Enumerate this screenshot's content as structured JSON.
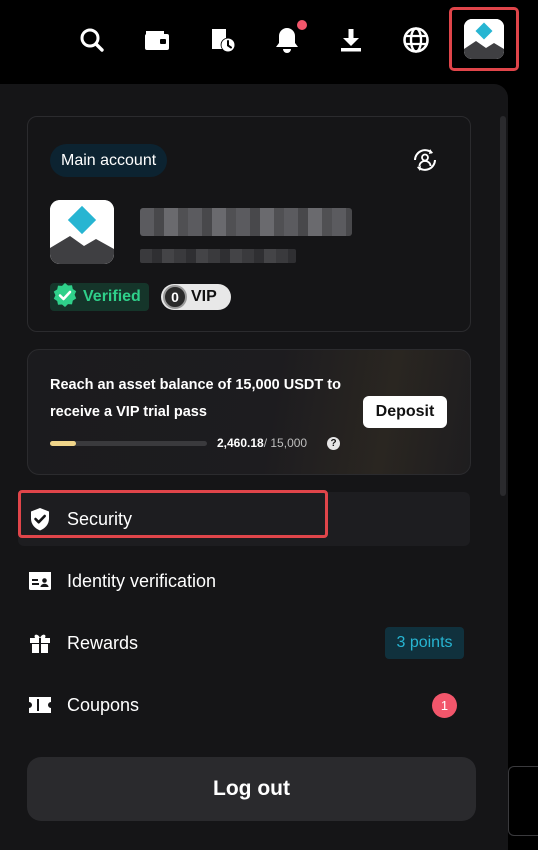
{
  "topbar": {
    "icons": [
      "search-icon",
      "wallet-icon",
      "order-history-icon",
      "bell-icon",
      "download-icon",
      "globe-icon"
    ],
    "notification_dot_color": "#f2566b",
    "highlight_color": "#e0454a"
  },
  "account": {
    "badge_label": "Main account",
    "verified_label": "Verified",
    "vip_level": "0",
    "vip_label": "VIP",
    "avatar_accent": "#27b5d2"
  },
  "vip_promo": {
    "message": "Reach an asset balance of 15,000 USDT to receive a VIP trial pass",
    "deposit_label": "Deposit",
    "progress_current": "2,460.18",
    "progress_total": "/ 15,000",
    "progress_fraction": 0.164,
    "progress_color": "#f0d58a",
    "help_label": "?"
  },
  "menu": {
    "items": [
      {
        "label": "Security",
        "icon": "shield-check-icon"
      },
      {
        "label": "Identity verification",
        "icon": "id-card-icon"
      },
      {
        "label": "Rewards",
        "icon": "gift-icon"
      },
      {
        "label": "Coupons",
        "icon": "ticket-icon"
      }
    ],
    "rewards_badge": "3 points",
    "coupons_count": "1"
  },
  "logout_label": "Log out"
}
